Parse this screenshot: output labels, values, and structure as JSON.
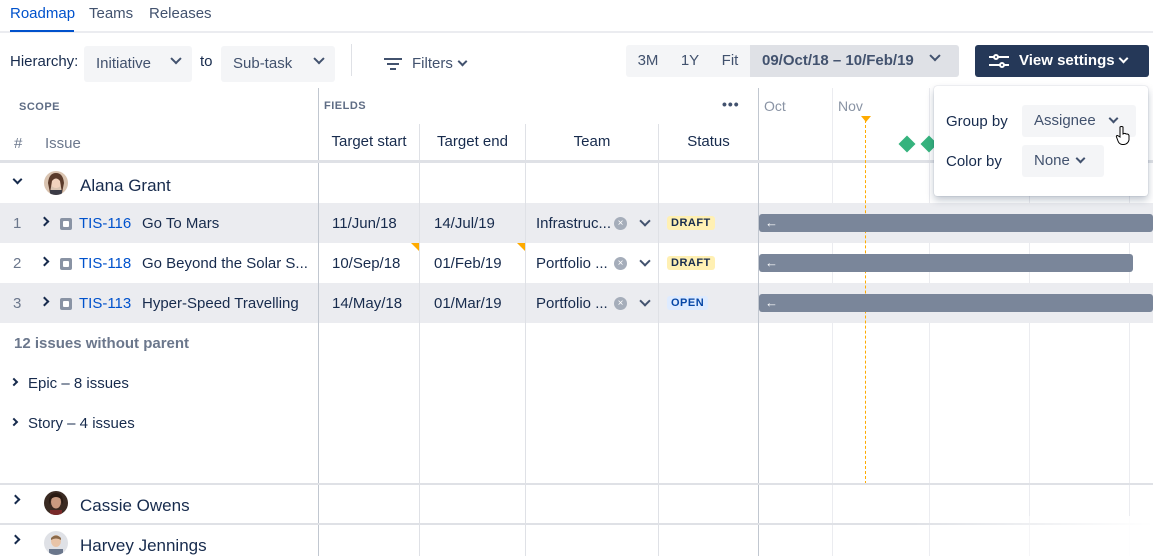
{
  "tabs": [
    {
      "label": "Roadmap",
      "active": true
    },
    {
      "label": "Teams",
      "active": false
    },
    {
      "label": "Releases",
      "active": false
    }
  ],
  "toolbar": {
    "hierarchy_label": "Hierarchy:",
    "hierarchy_from": "Initiative",
    "to_label": "to",
    "hierarchy_to": "Sub-task",
    "filters_label": "Filters",
    "zoom_options": [
      "3M",
      "1Y",
      "Fit"
    ],
    "date_range": "09/Oct/18 – 10/Feb/19",
    "view_settings_label": "View settings"
  },
  "headers": {
    "scope": "SCOPE",
    "fields": "FIELDS",
    "more": "•••",
    "num": "#",
    "issue": "Issue",
    "columns": [
      "Target start",
      "Target end",
      "Team",
      "Status"
    ],
    "months": [
      "Oct",
      "Nov"
    ]
  },
  "groups": [
    {
      "name": "Alana Grant",
      "expanded": true,
      "issues": [
        {
          "num": "1",
          "key": "TIS-116",
          "summary": "Go To Mars",
          "start": "11/Jun/18",
          "end": "14/Jul/19",
          "team": "Infrastruc...",
          "status": "DRAFT"
        },
        {
          "num": "2",
          "key": "TIS-118",
          "summary": "Go Beyond the Solar S...",
          "start": "10/Sep/18",
          "end": "01/Feb/19",
          "team": "Portfolio ...",
          "status": "DRAFT"
        },
        {
          "num": "3",
          "key": "TIS-113",
          "summary": "Hyper-Speed Travelling",
          "start": "14/May/18",
          "end": "01/Mar/19",
          "team": "Portfolio ...",
          "status": "OPEN"
        }
      ],
      "without_parent": "12 issues without parent",
      "subgroups": [
        "Epic – 8 issues",
        "Story – 4 issues"
      ]
    },
    {
      "name": "Cassie Owens",
      "expanded": false
    },
    {
      "name": "Harvey Jennings",
      "expanded": false
    }
  ],
  "view_settings": {
    "group_by_label": "Group by",
    "group_by_value": "Assignee",
    "color_by_label": "Color by",
    "color_by_value": "None"
  },
  "colors": {
    "accent": "#0052cc",
    "bar": "#7a869a",
    "primary_button": "#253858",
    "today": "#ffab00",
    "milestone": "#36b37e"
  }
}
